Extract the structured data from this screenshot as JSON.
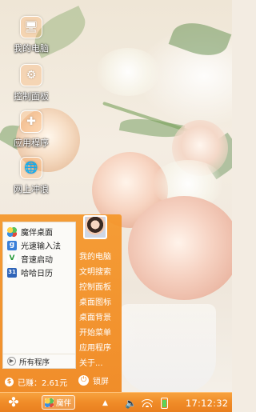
{
  "desktop": {
    "icons": [
      {
        "label": "我的电脑",
        "glyph": "🖥"
      },
      {
        "label": "控制面板",
        "glyph": "⚙"
      },
      {
        "label": "应用程序",
        "glyph": "✚"
      },
      {
        "label": "网上冲浪",
        "glyph": "🌐"
      }
    ]
  },
  "start_menu": {
    "programs": [
      {
        "label": "魔伴桌面",
        "icon": "magic-desktop-icon"
      },
      {
        "label": "光速输入法",
        "icon": "ime-icon",
        "glyph": "g"
      },
      {
        "label": "音速启动",
        "icon": "speed-launch-icon",
        "glyph": "V"
      },
      {
        "label": "哈哈日历",
        "icon": "calendar-icon",
        "glyph": "31"
      }
    ],
    "all_programs_label": "所有程序",
    "shortcuts": [
      "我的电脑",
      "文明搜索",
      "控制面板",
      "桌面图标",
      "桌面背景",
      "开始菜单",
      "应用程序",
      "关于..."
    ],
    "earnings_label": "已赚：2.61元",
    "lock_label": "锁屏"
  },
  "taskbar": {
    "start_glyph": "✤",
    "task_label": "魔伴",
    "tray_up_glyph": "▲",
    "volume_glyph": "🔈",
    "clock": "17:12:32"
  },
  "colors": {
    "accent": "#f08c28",
    "panel": "#fbfaf7"
  }
}
